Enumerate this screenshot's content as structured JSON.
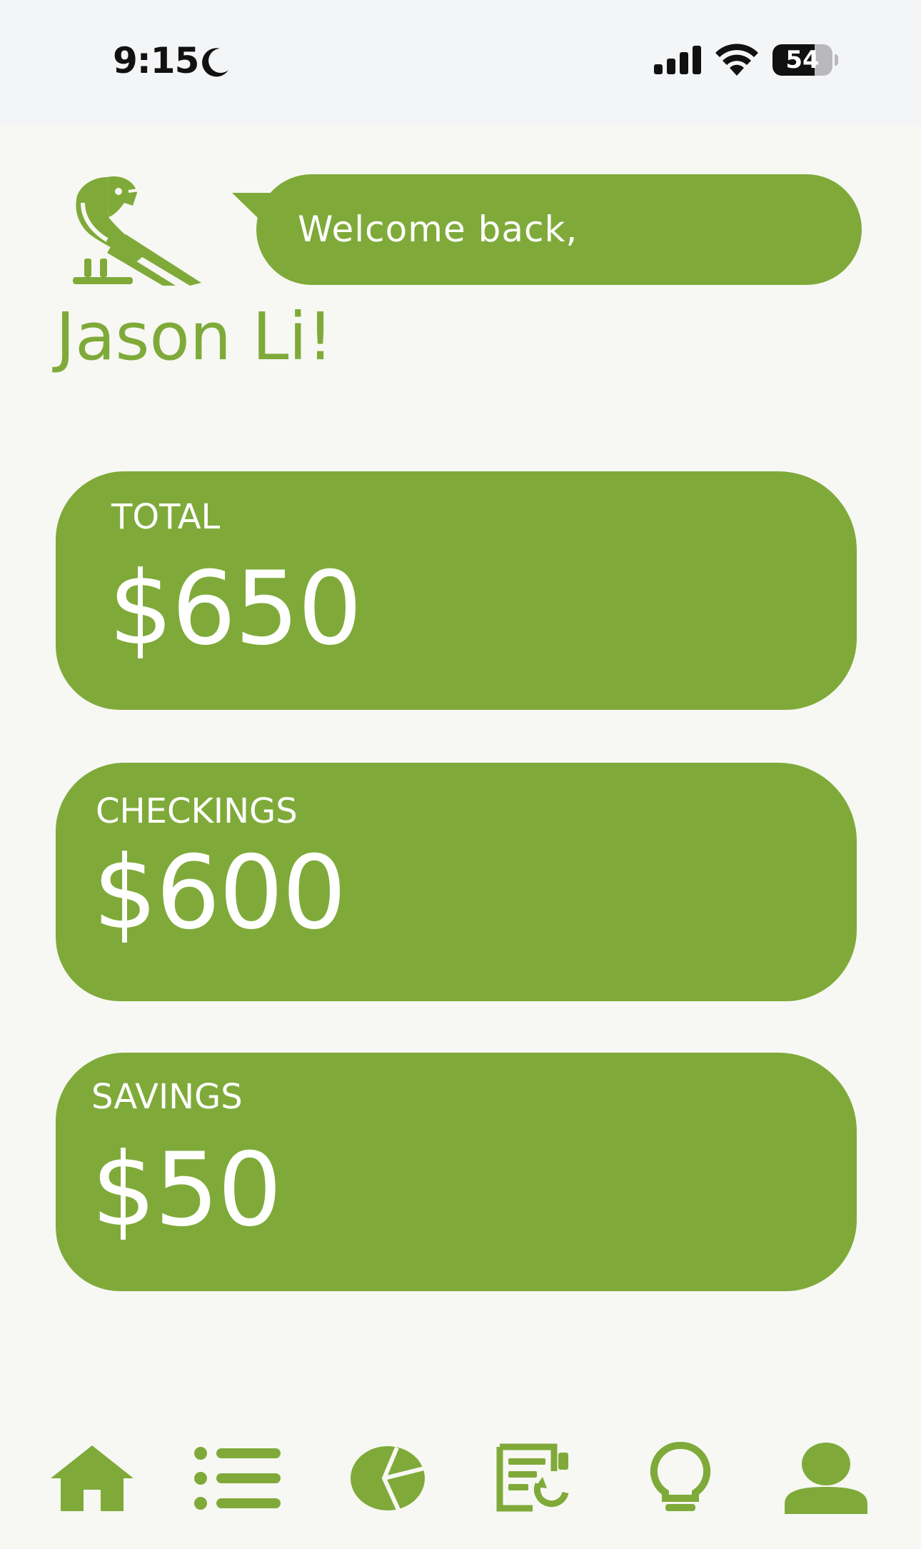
{
  "status_bar": {
    "time": "9:15",
    "battery_level": "54",
    "icons": [
      "moon-icon",
      "cellular-signal-icon",
      "wifi-icon",
      "battery-icon"
    ]
  },
  "header": {
    "logo": "parrot-icon",
    "welcome_text": "Welcome back,",
    "user_name": "Jason Li!"
  },
  "accounts": [
    {
      "label": "TOTAL",
      "amount": "$650"
    },
    {
      "label": "CHECKINGS",
      "amount": "$600"
    },
    {
      "label": "SAVINGS",
      "amount": "$50"
    }
  ],
  "bottom_nav": {
    "items": [
      {
        "icon": "home-icon"
      },
      {
        "icon": "list-icon"
      },
      {
        "icon": "pie-chart-icon"
      },
      {
        "icon": "report-icon"
      },
      {
        "icon": "lightbulb-icon"
      },
      {
        "icon": "profile-icon"
      }
    ]
  },
  "colors": {
    "brand_green": "#7faa3a",
    "background": "#f7f8f3",
    "status_bar_bg": "#f4f5f7"
  }
}
